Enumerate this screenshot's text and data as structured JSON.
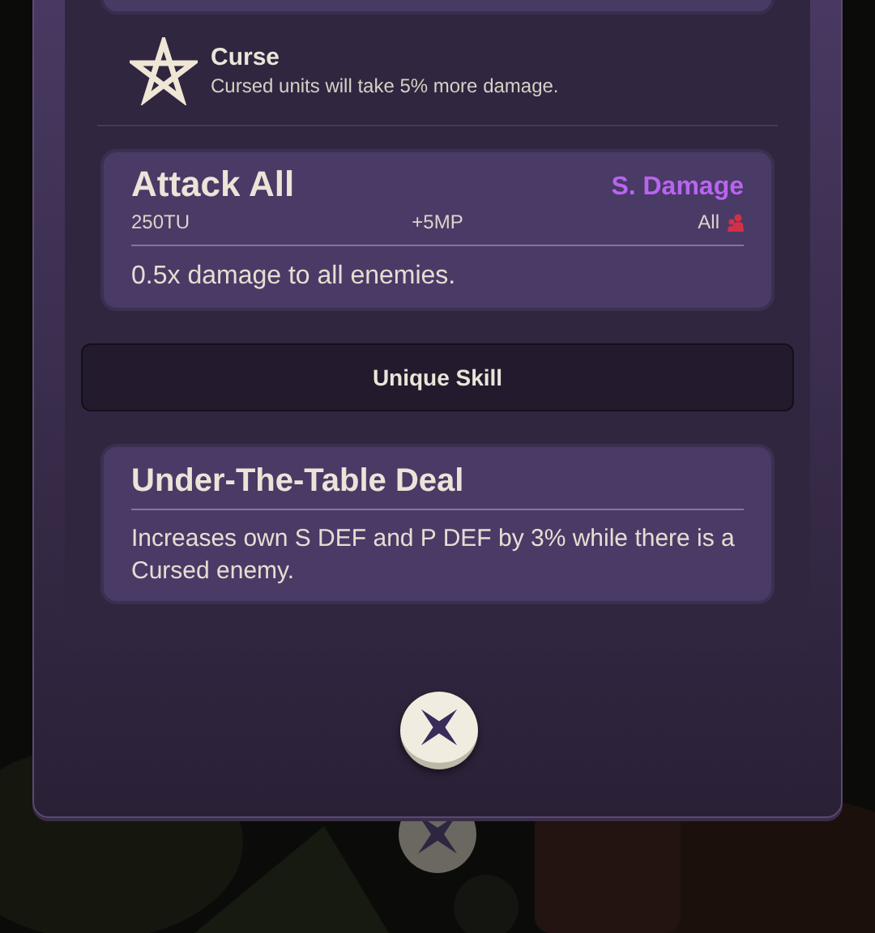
{
  "effect": {
    "name": "Curse",
    "description": "Cursed units will take 5% more damage."
  },
  "skill": {
    "name": "Attack All",
    "type": "S. Damage",
    "cost": "250TU",
    "mp": "+5MP",
    "target": "All",
    "description": "0.5x damage to all enemies."
  },
  "section_header": "Unique Skill",
  "unique_skill": {
    "name": "Under-The-Table Deal",
    "description": "Increases own S DEF and P DEF by 3% while there is a Cursed enemy."
  }
}
